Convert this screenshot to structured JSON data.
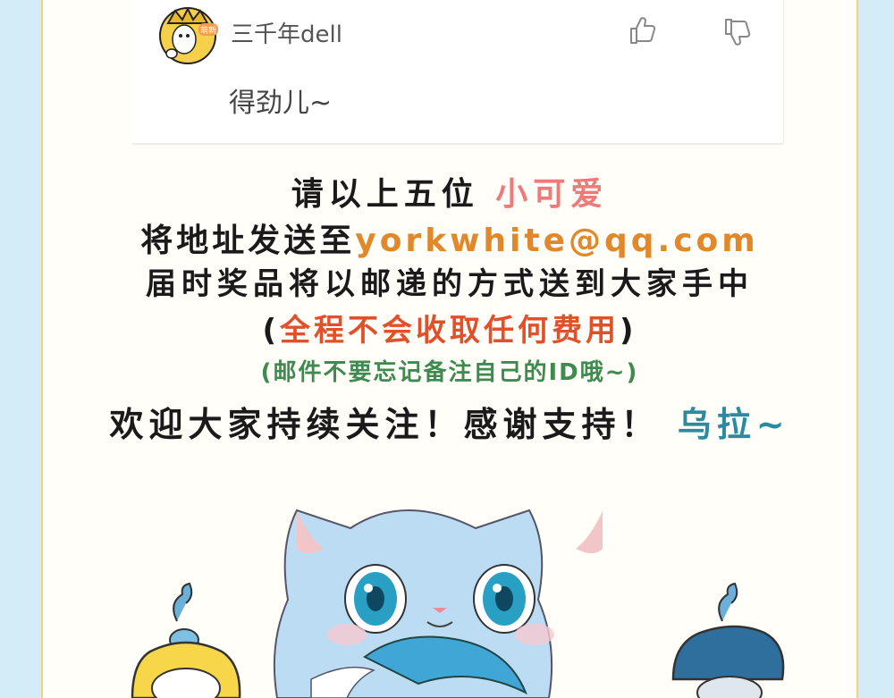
{
  "comment": {
    "username": "三千年dell",
    "text": "得劲儿~",
    "avatar_badge": "萌新",
    "icons": {
      "like": "thumbs-up-icon",
      "dislike": "thumbs-down-icon"
    }
  },
  "announcement": {
    "line1_prefix": "请以上五位",
    "line1_highlight": "小可爱",
    "line2_prefix": "将地址发送至",
    "line2_email": "yorkwhite@qq.com",
    "line3": "届时奖品将以邮递的方式送到大家手中",
    "line4_open": "(",
    "line4_highlight": "全程不会收取任何费用",
    "line4_close": ")",
    "line5": "(邮件不要忘记备注自己的ID哦~)",
    "line6_prefix": "欢迎大家持续关注！感谢支持！",
    "line6_highlight": "乌拉~"
  },
  "colors": {
    "pink": "#ef7a7a",
    "orange": "#e0882a",
    "red": "#e0502a",
    "green": "#3f8a4f",
    "teal": "#2b8aa0",
    "border_yellow": "#f3d27a",
    "side_blue": "#d4ecf7"
  }
}
